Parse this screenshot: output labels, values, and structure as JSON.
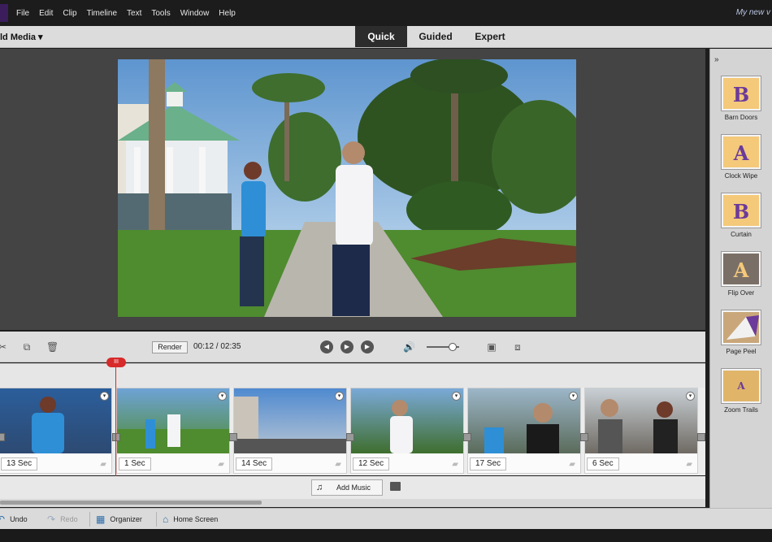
{
  "menu": {
    "items": [
      "File",
      "Edit",
      "Clip",
      "Timeline",
      "Text",
      "Tools",
      "Window",
      "Help"
    ],
    "doc_title": "My new v"
  },
  "modebar": {
    "add_media": "ld Media ▾",
    "tabs": [
      "Quick",
      "Guided",
      "Expert"
    ],
    "active_tab": "Quick"
  },
  "transport": {
    "render_label": "Render",
    "timecode": "00:12 / 02:35",
    "volume_level": 0.8
  },
  "playhead": {
    "label": "III"
  },
  "transitions": [
    {
      "name": "Barn Doors",
      "letter": "B"
    },
    {
      "name": "Clock Wipe",
      "letter": "A"
    },
    {
      "name": "Curtain",
      "letter": "B"
    },
    {
      "name": "Flip Over",
      "letter": "A"
    },
    {
      "name": "Page Peel",
      "letter": ""
    },
    {
      "name": "Zoom Trails",
      "letter": "A"
    }
  ],
  "clips": [
    {
      "duration": "13 Sec"
    },
    {
      "duration": "1 Sec"
    },
    {
      "duration": "14 Sec"
    },
    {
      "duration": "12 Sec"
    },
    {
      "duration": "17 Sec"
    },
    {
      "duration": "6 Sec"
    }
  ],
  "music": {
    "add_label": "Add Music"
  },
  "bottombar": {
    "undo": "Undo",
    "redo": "Redo",
    "organizer": "Organizer",
    "home": "Home Screen"
  },
  "colors": {
    "accent": "#2c2c2c",
    "playhead": "#d72a2a",
    "transition_bg": "#f4c97a"
  }
}
